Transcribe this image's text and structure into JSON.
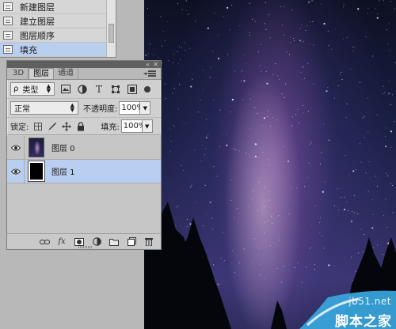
{
  "history_panel": {
    "items": [
      {
        "label": "新建图层"
      },
      {
        "label": "建立图层"
      },
      {
        "label": "图层顺序"
      },
      {
        "label": "填充"
      }
    ]
  },
  "layers_panel": {
    "tabs": [
      {
        "label": "3D"
      },
      {
        "label": "图层"
      },
      {
        "label": "通道"
      }
    ],
    "filter": {
      "kind_label": "类型",
      "glyph": "ρ"
    },
    "blend": {
      "mode": "正常",
      "opacity_label": "不透明度:",
      "opacity_value": "100%"
    },
    "lock": {
      "label": "锁定:",
      "fill_label": "填充:",
      "fill_value": "100%"
    },
    "layers": [
      {
        "name": "图层 0",
        "visible": true,
        "selected": false
      },
      {
        "name": "图层 1",
        "visible": true,
        "selected": true
      }
    ],
    "bottom_tools": {
      "fx_label": "fx"
    }
  },
  "watermark": {
    "site": "jb51.net",
    "name": "脚本之家"
  },
  "colors": {
    "selection": "#b9cff2",
    "panel_bg": "#d0d0d0",
    "titlebar": "#5f5f5f"
  }
}
